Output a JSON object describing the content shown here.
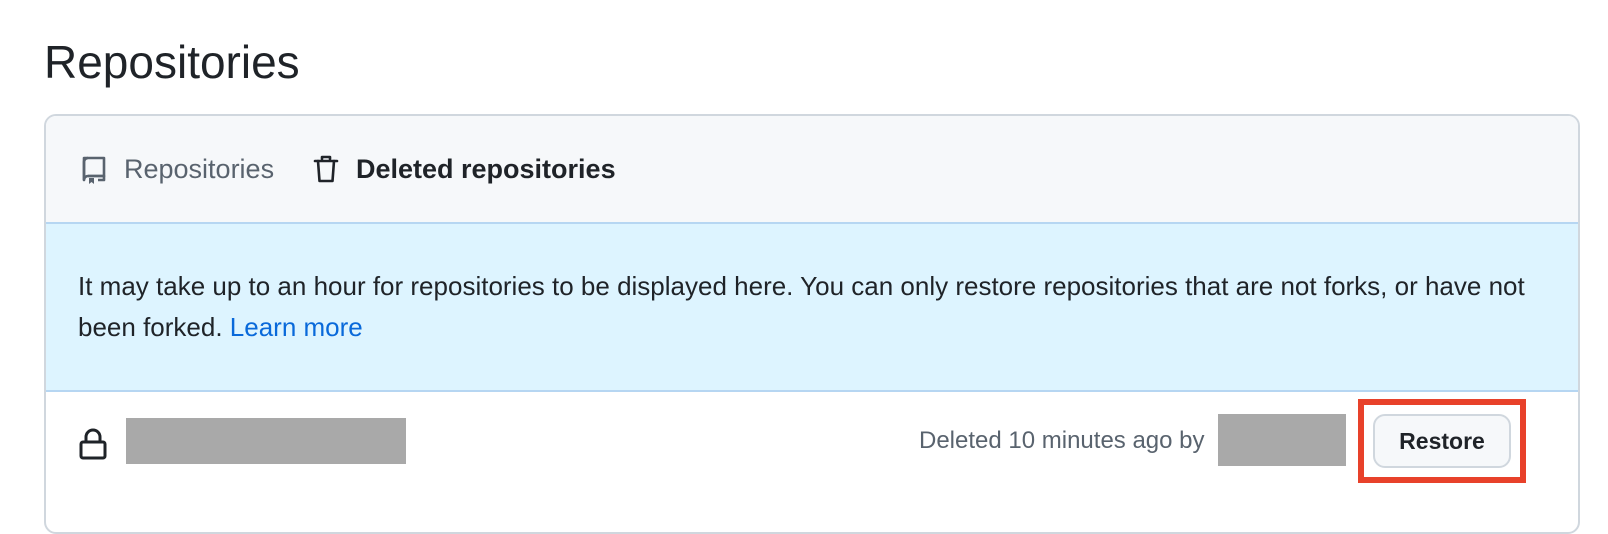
{
  "page": {
    "title": "Repositories"
  },
  "tabs": {
    "repositories": {
      "label": "Repositories",
      "icon": "repo-icon"
    },
    "deleted": {
      "label": "Deleted repositories",
      "icon": "trash-icon"
    }
  },
  "notice": {
    "text": "It may take up to an hour for repositories to be displayed here. You can only restore repositories that are not forks, or have not been forked. ",
    "link_label": "Learn more"
  },
  "deleted_repo": {
    "lock_icon": "lock-icon",
    "deleted_text": "Deleted 10 minutes ago by",
    "restore_label": "Restore"
  },
  "colors": {
    "notice_bg": "#ddf4ff",
    "link": "#0969da",
    "highlight": "#e8412a",
    "redaction": "#a9a9a9"
  }
}
